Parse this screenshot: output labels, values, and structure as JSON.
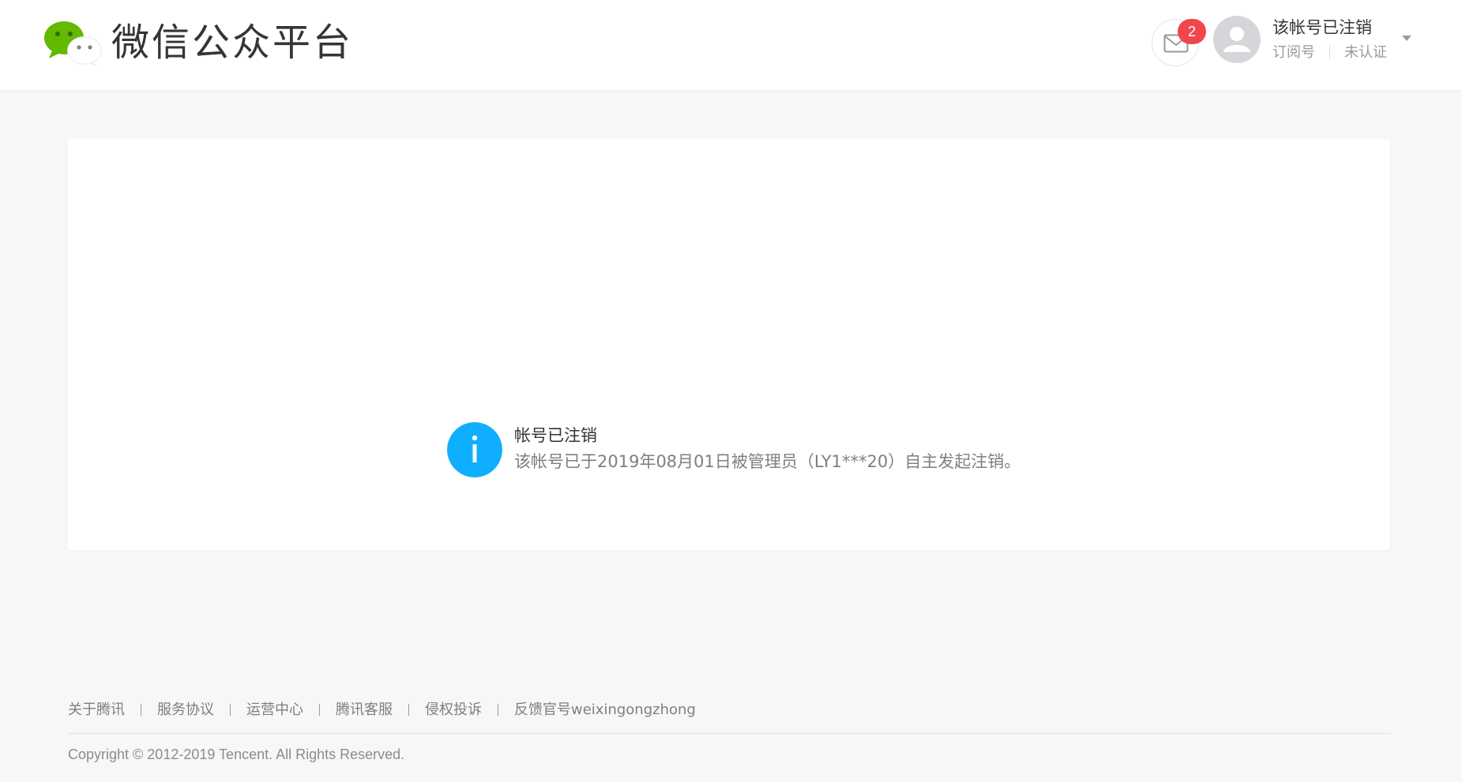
{
  "header": {
    "logo_title": "微信公众平台",
    "message_badge": "2",
    "account": {
      "name": "该帐号已注销",
      "type": "订阅号",
      "verification": "未认证"
    }
  },
  "notice": {
    "icon": "info-icon",
    "icon_glyph": "i",
    "title": "帐号已注销",
    "description": "该帐号已于2019年08月01日被管理员（LY1***20）自主发起注销。"
  },
  "footer": {
    "links": [
      "关于腾讯",
      "服务协议",
      "运营中心",
      "腾讯客服",
      "侵权投诉",
      "反馈官号weixingongzhong"
    ],
    "copyright": "Copyright © 2012-2019 Tencent. All Rights Reserved."
  },
  "colors": {
    "info_blue": "#10aeff",
    "badge_red": "#f2464e",
    "wechat_green": "#62b900",
    "page_bg": "#f6f7f9"
  }
}
